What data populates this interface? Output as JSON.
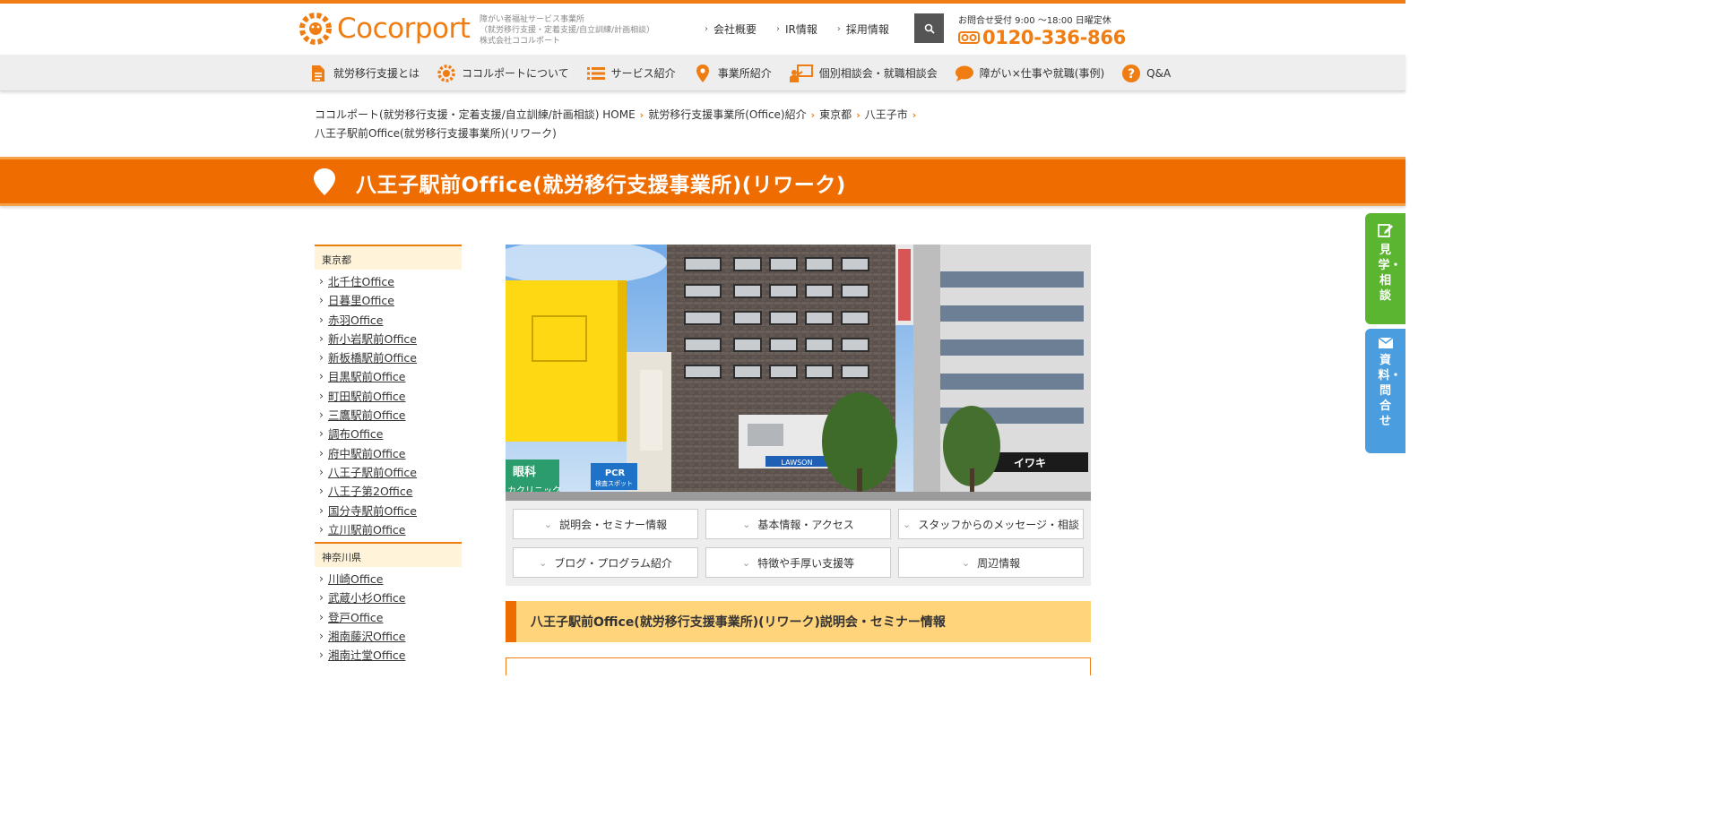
{
  "header": {
    "logo_text": "Cocorport",
    "tagline": [
      "障がい者福祉サービス事業所",
      "（就労移行支援・定着支援/自立訓練/計画相談）",
      "株式会社ココルポート"
    ],
    "top_links": [
      "会社概要",
      "IR情報",
      "採用情報"
    ],
    "contact_hours": "お問合せ受付 9:00 ～18:00 日曜定休",
    "phone": "0120-336-866"
  },
  "gnav": [
    {
      "label": "就労移行支援とは",
      "icon": "document-icon"
    },
    {
      "label": "ココルポートについて",
      "icon": "logo-icon"
    },
    {
      "label": "サービス紹介",
      "icon": "list-icon"
    },
    {
      "label": "事業所紹介",
      "icon": "map-pin-icon"
    },
    {
      "label": "個別相談会・就職相談会",
      "icon": "presentation-icon"
    },
    {
      "label": "障がい×仕事や就職(事例)",
      "icon": "speech-bubble-icon"
    },
    {
      "label": "Q&A",
      "icon": "question-icon"
    }
  ],
  "breadcrumb": [
    "ココルポート(就労移行支援・定着支援/自立訓練/計画相談) HOME",
    "就労移行支援事業所(Office)紹介",
    "東京都",
    "八王子市"
  ],
  "breadcrumb_current": "八王子駅前Office(就労移行支援事業所)(リワーク)",
  "page_title": "八王子駅前Office(就労移行支援事業所)(リワーク)",
  "sidebar": [
    {
      "heading": "東京都",
      "items": [
        "北千住Office",
        "日暮里Office",
        "赤羽Office",
        "新小岩駅前Office",
        "新板橋駅前Office",
        "目黒駅前Office",
        "町田駅前Office",
        "三鷹駅前Office",
        "調布Office",
        "府中駅前Office",
        "八王子駅前Office",
        "八王子第2Office",
        "国分寺駅前Office",
        "立川駅前Office"
      ]
    },
    {
      "heading": "神奈川県",
      "items": [
        "川崎Office",
        "武蔵小杉Office",
        "登戸Office",
        "湘南藤沢Office",
        "湘南辻堂Office"
      ]
    }
  ],
  "photo_signs": {
    "clinic": "眼科",
    "clinic_sub": "カクリニック",
    "pcr": "PCR",
    "pcr_sub": "検査スポット",
    "lawson": "LAWSON",
    "shop": "イワキ"
  },
  "tabs": [
    "説明会・セミナー情報",
    "基本情報・アクセス",
    "スタッフからのメッセージ・相談",
    "ブログ・プログラム紹介",
    "特徴や手厚い支援等",
    "周辺情報"
  ],
  "section_heading": "八王子駅前Office(就労移行支援事業所)(リワーク)説明会・セミナー情報",
  "float_buttons": [
    {
      "label": "見学・相談",
      "icon": "pencil-icon",
      "color": "#5cb531"
    },
    {
      "label": "資料・問合せ",
      "icon": "mail-icon",
      "color": "#4a9ee0"
    }
  ],
  "colors": {
    "accent": "#ef6c00",
    "highlight": "#ffd47a"
  }
}
